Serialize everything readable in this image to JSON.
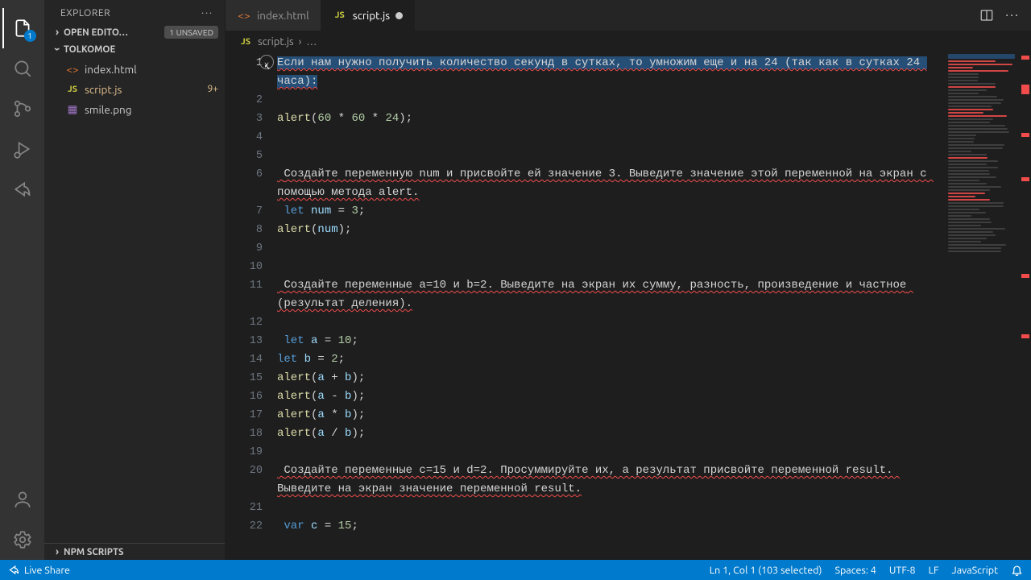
{
  "sidebar": {
    "title": "EXPLORER",
    "openEditors": {
      "label": "OPEN EDITO…",
      "unsaved": "1 UNSAVED"
    },
    "workspace": "TOLKOMOE",
    "files": [
      {
        "icon": "html",
        "name": "index.html",
        "modified": false
      },
      {
        "icon": "js",
        "name": "script.js",
        "modified": true,
        "badge": "9+"
      },
      {
        "icon": "img",
        "name": "smile.png",
        "modified": false
      }
    ],
    "npm": "NPM SCRIPTS"
  },
  "activity": {
    "explorer_badge": "1"
  },
  "tabs": [
    {
      "icon": "html",
      "label": "index.html",
      "active": false,
      "dirty": false
    },
    {
      "icon": "js",
      "label": "script.js",
      "active": true,
      "dirty": true
    }
  ],
  "breadcrumb": {
    "icon": "js",
    "file": "script.js",
    "sep": "›",
    "rest": "…"
  },
  "code_lines": [
    {
      "n": 1,
      "type": "sel-spell",
      "text": "Если нам нужно получить количество секунд в сутках, то умножим еще и на 24 (так как в сутках 24 часа):"
    },
    {
      "n": 2,
      "type": "blank",
      "text": ""
    },
    {
      "n": 3,
      "type": "alert-expr",
      "tokens": [
        "alert",
        "(",
        "60",
        " * ",
        "60",
        " * ",
        "24",
        ");"
      ]
    },
    {
      "n": 4,
      "type": "blank",
      "text": ""
    },
    {
      "n": 5,
      "type": "blank",
      "text": ""
    },
    {
      "n": 6,
      "type": "spell",
      "text": " Создайте переменную num и присвойте ей значение 3. Выведите значение этой переменной на экран с помощью метода alert."
    },
    {
      "n": 7,
      "type": "let",
      "tokens": [
        " ",
        "let",
        " ",
        "num",
        " = ",
        "3",
        ";"
      ]
    },
    {
      "n": 8,
      "type": "alert-var",
      "tokens": [
        "alert",
        "(",
        "num",
        ");"
      ]
    },
    {
      "n": 9,
      "type": "blank",
      "text": ""
    },
    {
      "n": 10,
      "type": "blank",
      "text": ""
    },
    {
      "n": 11,
      "type": "spell",
      "text": " Создайте переменные a=10 и b=2. Выведите на экран их сумму, разность, произведение и частное (результат деления)."
    },
    {
      "n": 12,
      "type": "blank",
      "text": ""
    },
    {
      "n": 13,
      "type": "let",
      "tokens": [
        " ",
        "let",
        " ",
        "a",
        " = ",
        "10",
        ";"
      ]
    },
    {
      "n": 14,
      "type": "let2",
      "tokens": [
        "let",
        " ",
        "b",
        " = ",
        "2",
        ";"
      ]
    },
    {
      "n": 15,
      "type": "alert-bin",
      "tokens": [
        "alert",
        "(",
        "a",
        " + ",
        "b",
        ");"
      ]
    },
    {
      "n": 16,
      "type": "alert-bin",
      "tokens": [
        "alert",
        "(",
        "a",
        " - ",
        "b",
        ");"
      ]
    },
    {
      "n": 17,
      "type": "alert-bin",
      "tokens": [
        "alert",
        "(",
        "a",
        " * ",
        "b",
        ");"
      ]
    },
    {
      "n": 18,
      "type": "alert-bin",
      "tokens": [
        "alert",
        "(",
        "a",
        " / ",
        "b",
        ");"
      ]
    },
    {
      "n": 19,
      "type": "blank",
      "text": ""
    },
    {
      "n": 20,
      "type": "spell",
      "text": " Создайте переменные c=15 и d=2. Просуммируйте их, а результат присвойте переменной result. Выведите на экран значение переменной result."
    },
    {
      "n": 21,
      "type": "blank",
      "text": ""
    },
    {
      "n": 22,
      "type": "var",
      "tokens": [
        " ",
        "var",
        " ",
        "c",
        " = ",
        "15",
        ";"
      ]
    }
  ],
  "status": {
    "liveShare": "Live Share",
    "selection": "Ln 1, Col 1 (103 selected)",
    "spaces": "Spaces: 4",
    "encoding": "UTF-8",
    "eol": "LF",
    "lang": "JavaScript"
  }
}
